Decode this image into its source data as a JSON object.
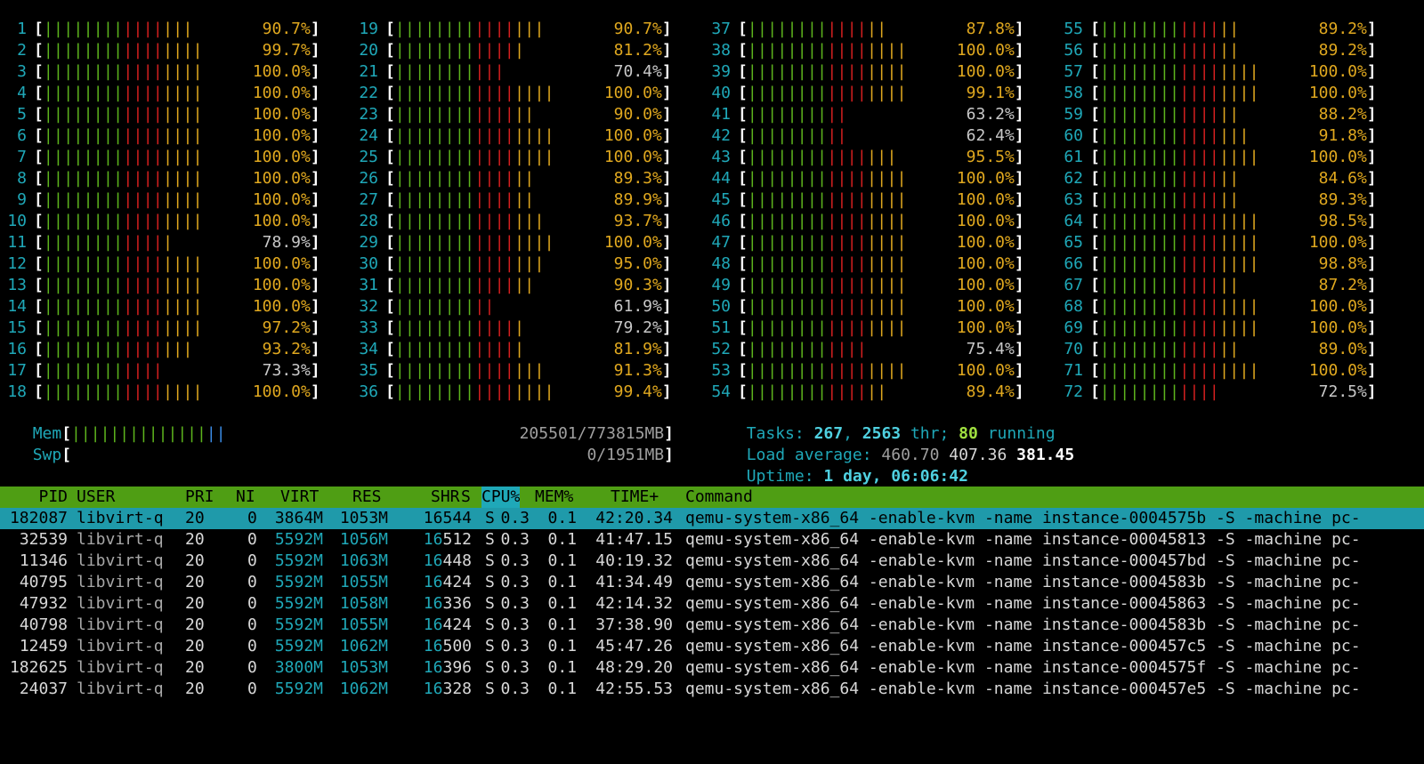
{
  "cpus": [
    {
      "n": "1",
      "p": "90.7%"
    },
    {
      "n": "2",
      "p": "99.7%"
    },
    {
      "n": "3",
      "p": "100.0%"
    },
    {
      "n": "4",
      "p": "100.0%"
    },
    {
      "n": "5",
      "p": "100.0%"
    },
    {
      "n": "6",
      "p": "100.0%"
    },
    {
      "n": "7",
      "p": "100.0%"
    },
    {
      "n": "8",
      "p": "100.0%"
    },
    {
      "n": "9",
      "p": "100.0%"
    },
    {
      "n": "10",
      "p": "100.0%"
    },
    {
      "n": "11",
      "p": "78.9%"
    },
    {
      "n": "12",
      "p": "100.0%"
    },
    {
      "n": "13",
      "p": "100.0%"
    },
    {
      "n": "14",
      "p": "100.0%"
    },
    {
      "n": "15",
      "p": "97.2%"
    },
    {
      "n": "16",
      "p": "93.2%"
    },
    {
      "n": "17",
      "p": "73.3%"
    },
    {
      "n": "18",
      "p": "100.0%"
    },
    {
      "n": "19",
      "p": "90.7%"
    },
    {
      "n": "20",
      "p": "81.2%"
    },
    {
      "n": "21",
      "p": "70.4%"
    },
    {
      "n": "22",
      "p": "100.0%"
    },
    {
      "n": "23",
      "p": "90.0%"
    },
    {
      "n": "24",
      "p": "100.0%"
    },
    {
      "n": "25",
      "p": "100.0%"
    },
    {
      "n": "26",
      "p": "89.3%"
    },
    {
      "n": "27",
      "p": "89.9%"
    },
    {
      "n": "28",
      "p": "93.7%"
    },
    {
      "n": "29",
      "p": "100.0%"
    },
    {
      "n": "30",
      "p": "95.0%"
    },
    {
      "n": "31",
      "p": "90.3%"
    },
    {
      "n": "32",
      "p": "61.9%"
    },
    {
      "n": "33",
      "p": "79.2%"
    },
    {
      "n": "34",
      "p": "81.9%"
    },
    {
      "n": "35",
      "p": "91.3%"
    },
    {
      "n": "36",
      "p": "99.4%"
    },
    {
      "n": "37",
      "p": "87.8%"
    },
    {
      "n": "38",
      "p": "100.0%"
    },
    {
      "n": "39",
      "p": "100.0%"
    },
    {
      "n": "40",
      "p": "99.1%"
    },
    {
      "n": "41",
      "p": "63.2%"
    },
    {
      "n": "42",
      "p": "62.4%"
    },
    {
      "n": "43",
      "p": "95.5%"
    },
    {
      "n": "44",
      "p": "100.0%"
    },
    {
      "n": "45",
      "p": "100.0%"
    },
    {
      "n": "46",
      "p": "100.0%"
    },
    {
      "n": "47",
      "p": "100.0%"
    },
    {
      "n": "48",
      "p": "100.0%"
    },
    {
      "n": "49",
      "p": "100.0%"
    },
    {
      "n": "50",
      "p": "100.0%"
    },
    {
      "n": "51",
      "p": "100.0%"
    },
    {
      "n": "52",
      "p": "75.4%"
    },
    {
      "n": "53",
      "p": "100.0%"
    },
    {
      "n": "54",
      "p": "89.4%"
    },
    {
      "n": "55",
      "p": "89.2%"
    },
    {
      "n": "56",
      "p": "89.2%"
    },
    {
      "n": "57",
      "p": "100.0%"
    },
    {
      "n": "58",
      "p": "100.0%"
    },
    {
      "n": "59",
      "p": "88.2%"
    },
    {
      "n": "60",
      "p": "91.8%"
    },
    {
      "n": "61",
      "p": "100.0%"
    },
    {
      "n": "62",
      "p": "84.6%"
    },
    {
      "n": "63",
      "p": "89.3%"
    },
    {
      "n": "64",
      "p": "98.5%"
    },
    {
      "n": "65",
      "p": "100.0%"
    },
    {
      "n": "66",
      "p": "98.8%"
    },
    {
      "n": "67",
      "p": "87.2%"
    },
    {
      "n": "68",
      "p": "100.0%"
    },
    {
      "n": "69",
      "p": "100.0%"
    },
    {
      "n": "70",
      "p": "89.0%"
    },
    {
      "n": "71",
      "p": "100.0%"
    },
    {
      "n": "72",
      "p": "72.5%"
    }
  ],
  "mem": {
    "label": "Mem",
    "value": "205501/773815MB",
    "fraction": 0.27
  },
  "swp": {
    "label": "Swp",
    "value": "0/1951MB",
    "fraction": 0
  },
  "tasks": {
    "label": "Tasks:",
    "count": "267",
    "sep": ",",
    "threads": "2563",
    "thr_label": "thr;",
    "running": "80",
    "running_label": "running"
  },
  "load": {
    "label": "Load average:",
    "one": "460.70",
    "five": "407.36",
    "fifteen": "381.45"
  },
  "uptime": {
    "label": "Uptime:",
    "value": "1 day, 06:06:42"
  },
  "header": {
    "pid": "PID",
    "user": "USER",
    "pri": "PRI",
    "ni": "NI",
    "virt": "VIRT",
    "res": "RES",
    "shr": "SHR",
    "s": "S",
    "cpu": "CPU%",
    "mem": "MEM%",
    "time": "TIME+",
    "cmd": "Command"
  },
  "processes": [
    {
      "pid": "182087",
      "user": "libvirt-q",
      "pri": "20",
      "ni": "0",
      "virt": "3864M",
      "res": "1053M",
      "shr_a": "16",
      "shr_b": "544",
      "s": "S",
      "cpu": "0.3",
      "mem": "0.1",
      "time": "42:20.34",
      "cmd": "qemu-system-x86_64 -enable-kvm -name instance-0004575b -S -machine pc-"
    },
    {
      "pid": "32539",
      "user": "libvirt-q",
      "pri": "20",
      "ni": "0",
      "virt": "5592M",
      "res": "1056M",
      "shr_a": "16",
      "shr_b": "512",
      "s": "S",
      "cpu": "0.3",
      "mem": "0.1",
      "time": "41:47.15",
      "cmd": "qemu-system-x86_64 -enable-kvm -name instance-00045813 -S -machine pc-"
    },
    {
      "pid": "11346",
      "user": "libvirt-q",
      "pri": "20",
      "ni": "0",
      "virt": "5592M",
      "res": "1063M",
      "shr_a": "16",
      "shr_b": "448",
      "s": "S",
      "cpu": "0.3",
      "mem": "0.1",
      "time": "40:19.32",
      "cmd": "qemu-system-x86_64 -enable-kvm -name instance-000457bd -S -machine pc-"
    },
    {
      "pid": "40795",
      "user": "libvirt-q",
      "pri": "20",
      "ni": "0",
      "virt": "5592M",
      "res": "1055M",
      "shr_a": "16",
      "shr_b": "424",
      "s": "S",
      "cpu": "0.3",
      "mem": "0.1",
      "time": "41:34.49",
      "cmd": "qemu-system-x86_64 -enable-kvm -name instance-0004583b -S -machine pc-"
    },
    {
      "pid": "47932",
      "user": "libvirt-q",
      "pri": "20",
      "ni": "0",
      "virt": "5592M",
      "res": "1058M",
      "shr_a": "16",
      "shr_b": "336",
      "s": "S",
      "cpu": "0.3",
      "mem": "0.1",
      "time": "42:14.32",
      "cmd": "qemu-system-x86_64 -enable-kvm -name instance-00045863 -S -machine pc-"
    },
    {
      "pid": "40798",
      "user": "libvirt-q",
      "pri": "20",
      "ni": "0",
      "virt": "5592M",
      "res": "1055M",
      "shr_a": "16",
      "shr_b": "424",
      "s": "S",
      "cpu": "0.3",
      "mem": "0.1",
      "time": "37:38.90",
      "cmd": "qemu-system-x86_64 -enable-kvm -name instance-0004583b -S -machine pc-"
    },
    {
      "pid": "12459",
      "user": "libvirt-q",
      "pri": "20",
      "ni": "0",
      "virt": "5592M",
      "res": "1062M",
      "shr_a": "16",
      "shr_b": "500",
      "s": "S",
      "cpu": "0.3",
      "mem": "0.1",
      "time": "45:47.26",
      "cmd": "qemu-system-x86_64 -enable-kvm -name instance-000457c5 -S -machine pc-"
    },
    {
      "pid": "182625",
      "user": "libvirt-q",
      "pri": "20",
      "ni": "0",
      "virt": "3800M",
      "res": "1053M",
      "shr_a": "16",
      "shr_b": "396",
      "s": "S",
      "cpu": "0.3",
      "mem": "0.1",
      "time": "48:29.20",
      "cmd": "qemu-system-x86_64 -enable-kvm -name instance-0004575f -S -machine pc-"
    },
    {
      "pid": "24037",
      "user": "libvirt-q",
      "pri": "20",
      "ni": "0",
      "virt": "5592M",
      "res": "1062M",
      "shr_a": "16",
      "shr_b": "328",
      "s": "S",
      "cpu": "0.3",
      "mem": "0.1",
      "time": "42:55.53",
      "cmd": "qemu-system-x86_64 -enable-kvm -name instance-000457e5 -S -machine pc-"
    }
  ],
  "colors": {
    "green": "#5db41d",
    "red": "#d41f1f",
    "yellow": "#e0a81f",
    "cyan": "#1fa8b8",
    "header_bg": "#4f9e14",
    "selected_bg": "#1f9aaa"
  }
}
